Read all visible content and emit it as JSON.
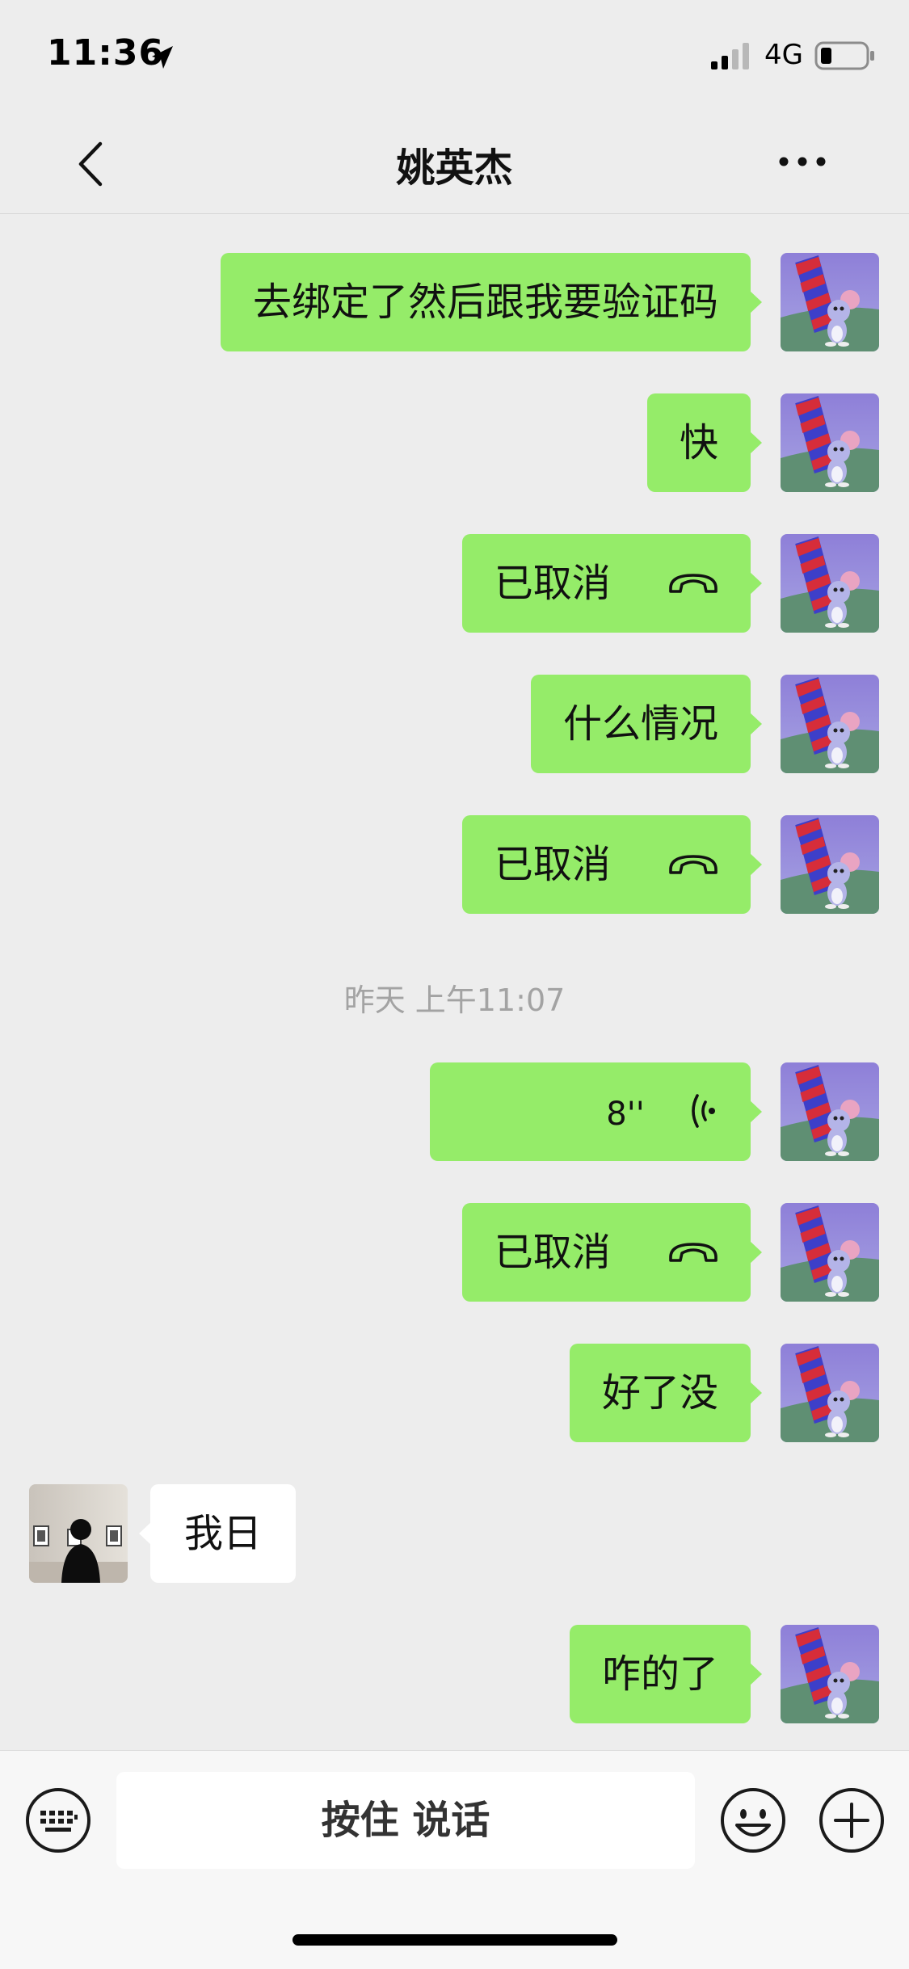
{
  "status_bar": {
    "time": "11:36",
    "network": "4G"
  },
  "nav": {
    "title": "姚英杰",
    "back_icon": "chevron-left-icon",
    "more_icon": "more-dots-icon"
  },
  "messages": [
    {
      "side": "out",
      "kind": "text",
      "text": "去绑定了然后跟我要验证码"
    },
    {
      "side": "out",
      "kind": "text",
      "text": "快"
    },
    {
      "side": "out",
      "kind": "call",
      "text": "已取消"
    },
    {
      "side": "out",
      "kind": "text",
      "text": "什么情况"
    },
    {
      "side": "out",
      "kind": "call",
      "text": "已取消"
    },
    {
      "kind": "timestamp",
      "text": "昨天 上午11:07"
    },
    {
      "side": "out",
      "kind": "voice",
      "text": "8''"
    },
    {
      "side": "out",
      "kind": "call",
      "text": "已取消"
    },
    {
      "side": "out",
      "kind": "text",
      "text": "好了没"
    },
    {
      "side": "in",
      "kind": "text",
      "text": "我日"
    },
    {
      "side": "out",
      "kind": "text",
      "text": "咋的了"
    }
  ],
  "input_bar": {
    "hold_to_talk_label": "按住 说话",
    "keyboard_icon": "keyboard-icon",
    "emoji_icon": "emoji-icon",
    "plus_icon": "plus-icon"
  },
  "colors": {
    "background": "#EDEDED",
    "outgoing_bubble": "#95EC69",
    "incoming_bubble": "#FFFFFF",
    "timestamp_text": "#A3A3A3"
  }
}
